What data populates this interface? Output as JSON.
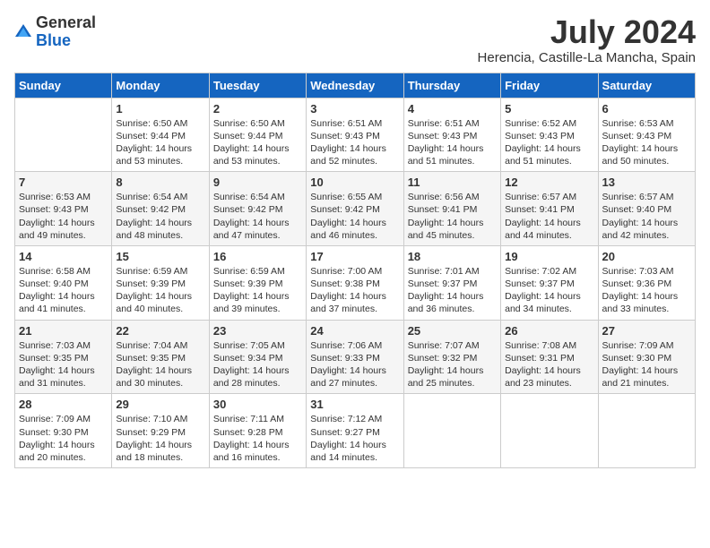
{
  "header": {
    "logo_general": "General",
    "logo_blue": "Blue",
    "month_title": "July 2024",
    "location": "Herencia, Castille-La Mancha, Spain"
  },
  "weekdays": [
    "Sunday",
    "Monday",
    "Tuesday",
    "Wednesday",
    "Thursday",
    "Friday",
    "Saturday"
  ],
  "weeks": [
    [
      {
        "day": "",
        "info": ""
      },
      {
        "day": "1",
        "info": "Sunrise: 6:50 AM\nSunset: 9:44 PM\nDaylight: 14 hours\nand 53 minutes."
      },
      {
        "day": "2",
        "info": "Sunrise: 6:50 AM\nSunset: 9:44 PM\nDaylight: 14 hours\nand 53 minutes."
      },
      {
        "day": "3",
        "info": "Sunrise: 6:51 AM\nSunset: 9:43 PM\nDaylight: 14 hours\nand 52 minutes."
      },
      {
        "day": "4",
        "info": "Sunrise: 6:51 AM\nSunset: 9:43 PM\nDaylight: 14 hours\nand 51 minutes."
      },
      {
        "day": "5",
        "info": "Sunrise: 6:52 AM\nSunset: 9:43 PM\nDaylight: 14 hours\nand 51 minutes."
      },
      {
        "day": "6",
        "info": "Sunrise: 6:53 AM\nSunset: 9:43 PM\nDaylight: 14 hours\nand 50 minutes."
      }
    ],
    [
      {
        "day": "7",
        "info": "Sunrise: 6:53 AM\nSunset: 9:43 PM\nDaylight: 14 hours\nand 49 minutes."
      },
      {
        "day": "8",
        "info": "Sunrise: 6:54 AM\nSunset: 9:42 PM\nDaylight: 14 hours\nand 48 minutes."
      },
      {
        "day": "9",
        "info": "Sunrise: 6:54 AM\nSunset: 9:42 PM\nDaylight: 14 hours\nand 47 minutes."
      },
      {
        "day": "10",
        "info": "Sunrise: 6:55 AM\nSunset: 9:42 PM\nDaylight: 14 hours\nand 46 minutes."
      },
      {
        "day": "11",
        "info": "Sunrise: 6:56 AM\nSunset: 9:41 PM\nDaylight: 14 hours\nand 45 minutes."
      },
      {
        "day": "12",
        "info": "Sunrise: 6:57 AM\nSunset: 9:41 PM\nDaylight: 14 hours\nand 44 minutes."
      },
      {
        "day": "13",
        "info": "Sunrise: 6:57 AM\nSunset: 9:40 PM\nDaylight: 14 hours\nand 42 minutes."
      }
    ],
    [
      {
        "day": "14",
        "info": "Sunrise: 6:58 AM\nSunset: 9:40 PM\nDaylight: 14 hours\nand 41 minutes."
      },
      {
        "day": "15",
        "info": "Sunrise: 6:59 AM\nSunset: 9:39 PM\nDaylight: 14 hours\nand 40 minutes."
      },
      {
        "day": "16",
        "info": "Sunrise: 6:59 AM\nSunset: 9:39 PM\nDaylight: 14 hours\nand 39 minutes."
      },
      {
        "day": "17",
        "info": "Sunrise: 7:00 AM\nSunset: 9:38 PM\nDaylight: 14 hours\nand 37 minutes."
      },
      {
        "day": "18",
        "info": "Sunrise: 7:01 AM\nSunset: 9:37 PM\nDaylight: 14 hours\nand 36 minutes."
      },
      {
        "day": "19",
        "info": "Sunrise: 7:02 AM\nSunset: 9:37 PM\nDaylight: 14 hours\nand 34 minutes."
      },
      {
        "day": "20",
        "info": "Sunrise: 7:03 AM\nSunset: 9:36 PM\nDaylight: 14 hours\nand 33 minutes."
      }
    ],
    [
      {
        "day": "21",
        "info": "Sunrise: 7:03 AM\nSunset: 9:35 PM\nDaylight: 14 hours\nand 31 minutes."
      },
      {
        "day": "22",
        "info": "Sunrise: 7:04 AM\nSunset: 9:35 PM\nDaylight: 14 hours\nand 30 minutes."
      },
      {
        "day": "23",
        "info": "Sunrise: 7:05 AM\nSunset: 9:34 PM\nDaylight: 14 hours\nand 28 minutes."
      },
      {
        "day": "24",
        "info": "Sunrise: 7:06 AM\nSunset: 9:33 PM\nDaylight: 14 hours\nand 27 minutes."
      },
      {
        "day": "25",
        "info": "Sunrise: 7:07 AM\nSunset: 9:32 PM\nDaylight: 14 hours\nand 25 minutes."
      },
      {
        "day": "26",
        "info": "Sunrise: 7:08 AM\nSunset: 9:31 PM\nDaylight: 14 hours\nand 23 minutes."
      },
      {
        "day": "27",
        "info": "Sunrise: 7:09 AM\nSunset: 9:30 PM\nDaylight: 14 hours\nand 21 minutes."
      }
    ],
    [
      {
        "day": "28",
        "info": "Sunrise: 7:09 AM\nSunset: 9:30 PM\nDaylight: 14 hours\nand 20 minutes."
      },
      {
        "day": "29",
        "info": "Sunrise: 7:10 AM\nSunset: 9:29 PM\nDaylight: 14 hours\nand 18 minutes."
      },
      {
        "day": "30",
        "info": "Sunrise: 7:11 AM\nSunset: 9:28 PM\nDaylight: 14 hours\nand 16 minutes."
      },
      {
        "day": "31",
        "info": "Sunrise: 7:12 AM\nSunset: 9:27 PM\nDaylight: 14 hours\nand 14 minutes."
      },
      {
        "day": "",
        "info": ""
      },
      {
        "day": "",
        "info": ""
      },
      {
        "day": "",
        "info": ""
      }
    ]
  ]
}
